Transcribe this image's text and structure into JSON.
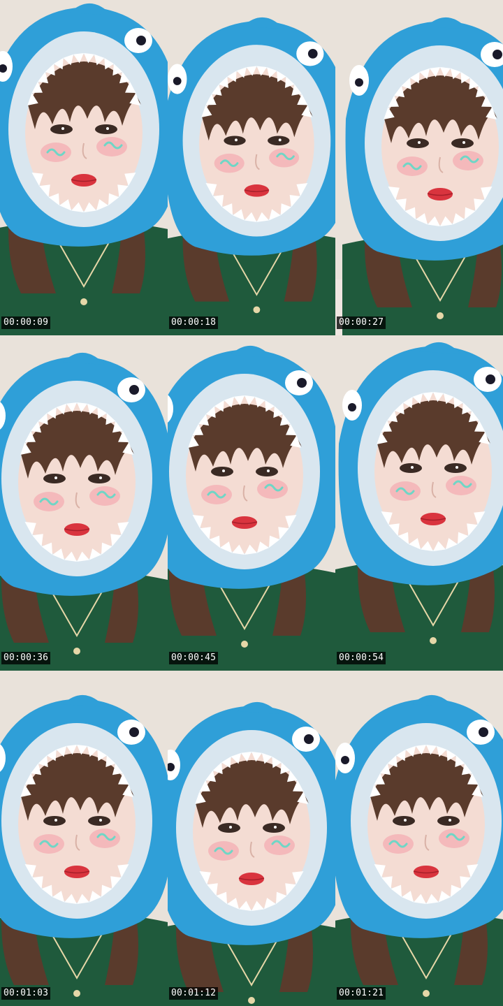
{
  "frames": [
    {
      "timestamp": "00:00:09"
    },
    {
      "timestamp": "00:00:18"
    },
    {
      "timestamp": "00:00:27"
    },
    {
      "timestamp": "00:00:36"
    },
    {
      "timestamp": "00:00:45"
    },
    {
      "timestamp": "00:00:54"
    },
    {
      "timestamp": "00:01:03"
    },
    {
      "timestamp": "00:01:12"
    },
    {
      "timestamp": "00:01:21"
    }
  ],
  "colors": {
    "hood_blue": "#2f9fd8",
    "hood_rim": "#d9e6ef",
    "pajama_green": "#1f5a3c",
    "hair_brown": "#5a3b2c",
    "skin": "#f4dcd3",
    "lips": "#d9343e",
    "cheek_mark": "#6fd6c6",
    "background": "#e9e2da"
  }
}
